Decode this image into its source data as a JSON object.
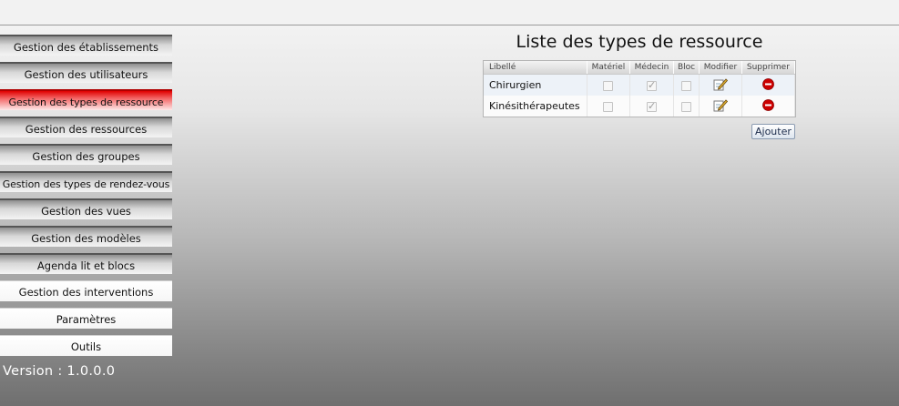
{
  "nav": {
    "items": [
      {
        "label": "Gestion des établissements",
        "state": "normal"
      },
      {
        "label": "Gestion des utilisateurs",
        "state": "normal"
      },
      {
        "label": "Gestion des types de ressource",
        "state": "active"
      },
      {
        "label": "Gestion des ressources",
        "state": "normal"
      },
      {
        "label": "Gestion des groupes",
        "state": "normal"
      },
      {
        "label": "Gestion des types de rendez-vous",
        "state": "normal"
      },
      {
        "label": "Gestion des vues",
        "state": "normal"
      },
      {
        "label": "Gestion des modèles",
        "state": "normal"
      },
      {
        "label": "Agenda lit et blocs",
        "state": "normal"
      },
      {
        "label": "Gestion des interventions",
        "state": "plain"
      },
      {
        "label": "Paramètres",
        "state": "plain"
      },
      {
        "label": "Outils",
        "state": "plain"
      }
    ]
  },
  "version": "Version : 1.0.0.0",
  "main": {
    "title": "Liste des types de ressource",
    "columns": [
      "Libellé",
      "Matériel",
      "Médecin",
      "Bloc",
      "Modifier",
      "Supprimer"
    ],
    "rows": [
      {
        "label": "Chirurgien",
        "materiel": false,
        "medecin": true,
        "bloc": false
      },
      {
        "label": "Kinésithérapeutes",
        "materiel": false,
        "medecin": true,
        "bloc": false
      }
    ],
    "add_label": "Ajouter"
  },
  "colors": {
    "active_nav": "#e00000",
    "delete_icon": "#cc0000"
  },
  "icons": {
    "edit": "edit-icon",
    "delete": "delete-icon"
  }
}
